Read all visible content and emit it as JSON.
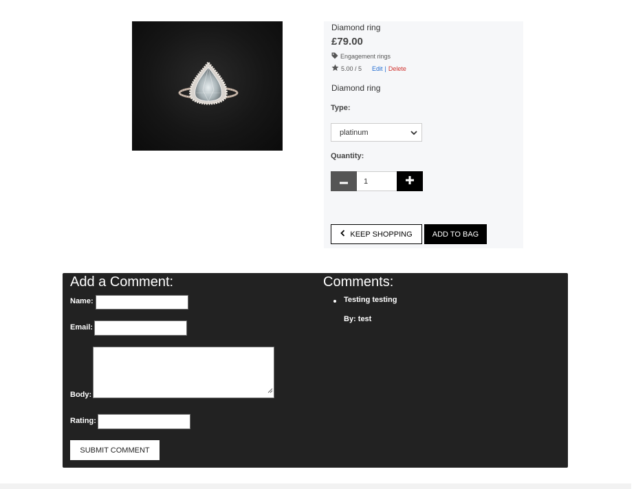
{
  "product": {
    "name": "Diamond ring",
    "price": "£79.00",
    "category": "Engagement rings",
    "rating": "5.00 / 5",
    "edit_label": "Edit",
    "separator": "|",
    "delete_label": "Delete",
    "description": "Diamond ring",
    "type_label": "Type:",
    "type_selected": "platinum",
    "quantity_label": "Quantity:",
    "quantity_value": "1",
    "keep_shopping_label": "KEEP SHOPPING",
    "add_to_bag_label": "ADD TO BAG",
    "icons": {
      "category": "tag-icon",
      "rating": "star-icon",
      "select": "chevron-down-icon",
      "minus": "minus-icon",
      "plus": "plus-icon",
      "back": "chevron-left-icon"
    }
  },
  "comment_form": {
    "title": "Add a Comment:",
    "name_label": "Name:",
    "email_label": "Email:",
    "body_label": "Body:",
    "rating_label": "Rating:",
    "submit_label": "SUBMIT COMMENT"
  },
  "comments": {
    "title": "Comments:",
    "items": [
      {
        "body": "Testing testing",
        "author": "By: test"
      }
    ]
  },
  "colors": {
    "panel_bg": "#f6f7f9",
    "comments_bg": "#222222",
    "edit_link": "#1f6bd1",
    "delete_link": "#d0312d",
    "button_dark": "#000000",
    "minus_button": "#555555"
  }
}
